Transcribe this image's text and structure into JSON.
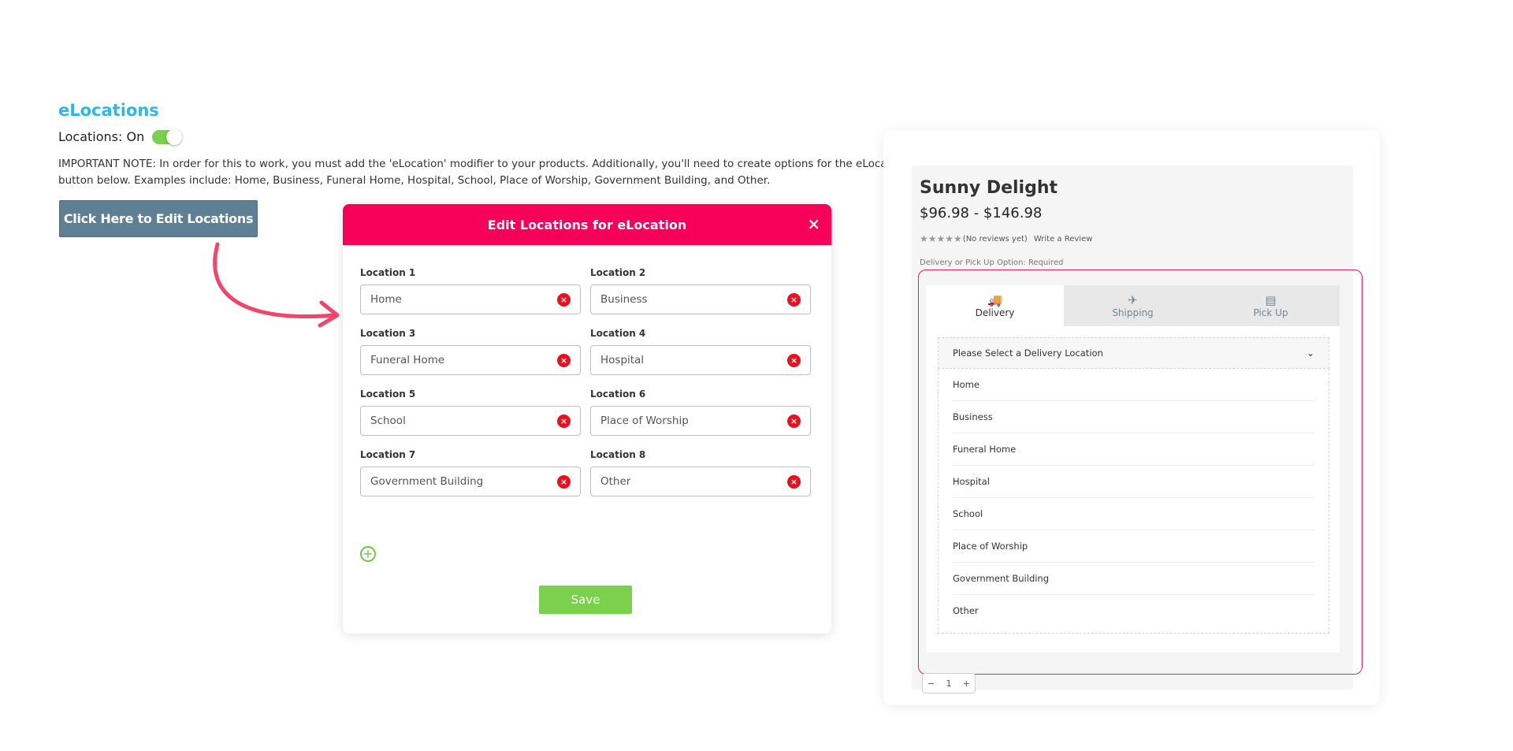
{
  "settings": {
    "section_title": "eLocations",
    "locations_label": "Locations: On",
    "toggle_on": true,
    "note_line1": "IMPORTANT NOTE: In order for this to work, you must add the 'eLocation' modifier to your products. Additionally, you'll need to create options for the eLocation dropdo",
    "note_line2": "button below. Examples include: Home, Business, Funeral Home, Hospital, School, Place of Worship, Government Building, and Other.",
    "edit_button": "Click Here to Edit Locations"
  },
  "modal": {
    "title": "Edit Locations for eLocation",
    "close": "×",
    "locations": [
      {
        "label": "Location 1",
        "value": "Home"
      },
      {
        "label": "Location 2",
        "value": "Business"
      },
      {
        "label": "Location 3",
        "value": "Funeral Home"
      },
      {
        "label": "Location 4",
        "value": "Hospital"
      },
      {
        "label": "Location 5",
        "value": "School"
      },
      {
        "label": "Location 6",
        "value": "Place of Worship"
      },
      {
        "label": "Location 7",
        "value": "Government Building"
      },
      {
        "label": "Location 8",
        "value": "Other"
      }
    ],
    "remove_icon": "×",
    "add_icon": "+",
    "save_button": "Save"
  },
  "product": {
    "title": "Sunny Delight",
    "price": "$96.98 - $146.98",
    "stars": "★★★★★",
    "reviews": "(No reviews yet)",
    "write_review": "Write a Review",
    "option_label": "Delivery or Pick Up Option:",
    "option_required": "Required",
    "tabs": [
      {
        "label": "Delivery",
        "icon": "truck-icon",
        "glyph": "🚚",
        "active": true
      },
      {
        "label": "Shipping",
        "icon": "plane-icon",
        "glyph": "✈",
        "active": false
      },
      {
        "label": "Pick Up",
        "icon": "store-icon",
        "glyph": "▤",
        "active": false
      }
    ],
    "select_placeholder": "Please Select a Delivery Location",
    "select_chevron": "⌄",
    "delivery_locations": [
      "Home",
      "Business",
      "Funeral Home",
      "Hospital",
      "School",
      "Place of Worship",
      "Government Building",
      "Other"
    ],
    "qty_minus": "−",
    "qty_value": "1",
    "qty_plus": "+"
  },
  "colors": {
    "accent_blue": "#2fb7e6",
    "modal_header": "#f7005a",
    "toggle_green": "#7bd04d",
    "save_green": "#7bd04d",
    "remove_red": "#e8121e",
    "highlight_pink": "#e0245e"
  }
}
